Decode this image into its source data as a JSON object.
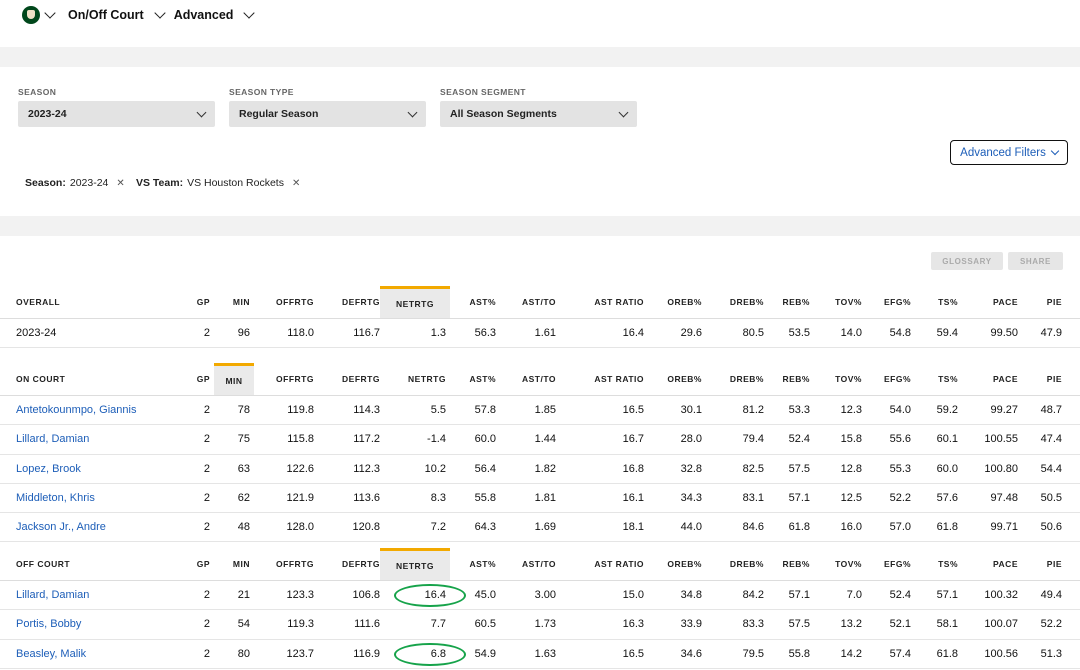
{
  "header": {
    "team_logo_icon": "bucks-logo-icon",
    "nav_view": "On/Off Court",
    "nav_measure": "Advanced"
  },
  "filters": {
    "season": {
      "label": "SEASON",
      "value": "2023-24"
    },
    "season_type": {
      "label": "SEASON TYPE",
      "value": "Regular Season"
    },
    "season_segment": {
      "label": "SEASON SEGMENT",
      "value": "All Season Segments"
    },
    "advanced_filters_label": "Advanced Filters",
    "chips": [
      {
        "key": "Season:",
        "value": "2023-24"
      },
      {
        "key": "VS Team:",
        "value": "VS Houston Rockets"
      }
    ]
  },
  "actions": {
    "glossary": "GLOSSARY",
    "share": "SHARE"
  },
  "columns": [
    "GP",
    "MIN",
    "OFFRTG",
    "DEFRTG",
    "NETRTG",
    "AST%",
    "AST/TO",
    "AST RATIO",
    "OREB%",
    "DREB%",
    "REB%",
    "TOV%",
    "EFG%",
    "TS%",
    "PACE",
    "PIE"
  ],
  "sections": [
    {
      "title": "OVERALL",
      "sorted_column": "NETRTG",
      "rows": [
        {
          "name": "2023-24",
          "is_player": false,
          "values": [
            "2",
            "96",
            "118.0",
            "116.7",
            "1.3",
            "56.3",
            "1.61",
            "16.4",
            "29.6",
            "80.5",
            "53.5",
            "14.0",
            "54.8",
            "59.4",
            "99.50",
            "47.9"
          ]
        }
      ]
    },
    {
      "title": "ON COURT",
      "sorted_column": "MIN",
      "rows": [
        {
          "name": "Antetokounmpo, Giannis",
          "is_player": true,
          "values": [
            "2",
            "78",
            "119.8",
            "114.3",
            "5.5",
            "57.8",
            "1.85",
            "16.5",
            "30.1",
            "81.2",
            "53.3",
            "12.3",
            "54.0",
            "59.2",
            "99.27",
            "48.7"
          ]
        },
        {
          "name": "Lillard, Damian",
          "is_player": true,
          "values": [
            "2",
            "75",
            "115.8",
            "117.2",
            "-1.4",
            "60.0",
            "1.44",
            "16.7",
            "28.0",
            "79.4",
            "52.4",
            "15.8",
            "55.6",
            "60.1",
            "100.55",
            "47.4"
          ]
        },
        {
          "name": "Lopez, Brook",
          "is_player": true,
          "values": [
            "2",
            "63",
            "122.6",
            "112.3",
            "10.2",
            "56.4",
            "1.82",
            "16.8",
            "32.8",
            "82.5",
            "57.5",
            "12.8",
            "55.3",
            "60.0",
            "100.80",
            "54.4"
          ]
        },
        {
          "name": "Middleton, Khris",
          "is_player": true,
          "values": [
            "2",
            "62",
            "121.9",
            "113.6",
            "8.3",
            "55.8",
            "1.81",
            "16.1",
            "34.3",
            "83.1",
            "57.1",
            "12.5",
            "52.2",
            "57.6",
            "97.48",
            "50.5"
          ]
        },
        {
          "name": "Jackson Jr., Andre",
          "is_player": true,
          "values": [
            "2",
            "48",
            "128.0",
            "120.8",
            "7.2",
            "64.3",
            "1.69",
            "18.1",
            "44.0",
            "84.6",
            "61.8",
            "16.0",
            "57.0",
            "61.8",
            "99.71",
            "50.6"
          ]
        }
      ]
    },
    {
      "title": "OFF COURT",
      "sorted_column": "NETRTG",
      "rows": [
        {
          "name": "Lillard, Damian",
          "is_player": true,
          "values": [
            "2",
            "21",
            "123.3",
            "106.8",
            "16.4",
            "45.0",
            "3.00",
            "15.0",
            "34.8",
            "84.2",
            "57.1",
            "7.0",
            "52.4",
            "57.1",
            "100.32",
            "49.4"
          ]
        },
        {
          "name": "Portis, Bobby",
          "is_player": true,
          "values": [
            "2",
            "54",
            "119.3",
            "111.6",
            "7.7",
            "60.5",
            "1.73",
            "16.3",
            "33.9",
            "83.3",
            "57.5",
            "13.2",
            "52.1",
            "58.1",
            "100.07",
            "52.2"
          ]
        },
        {
          "name": "Beasley, Malik",
          "is_player": true,
          "values": [
            "2",
            "80",
            "123.7",
            "116.9",
            "6.8",
            "54.9",
            "1.63",
            "16.5",
            "34.6",
            "79.5",
            "55.8",
            "14.2",
            "57.4",
            "61.8",
            "100.56",
            "51.3"
          ]
        }
      ]
    }
  ],
  "annotations": {
    "circled_values": [
      "16.4",
      "6.8"
    ],
    "circle_color": "#16a34a"
  },
  "colors": {
    "link": "#1d5eb8",
    "sort_accent": "#f2a900",
    "team_green": "#00471b"
  }
}
